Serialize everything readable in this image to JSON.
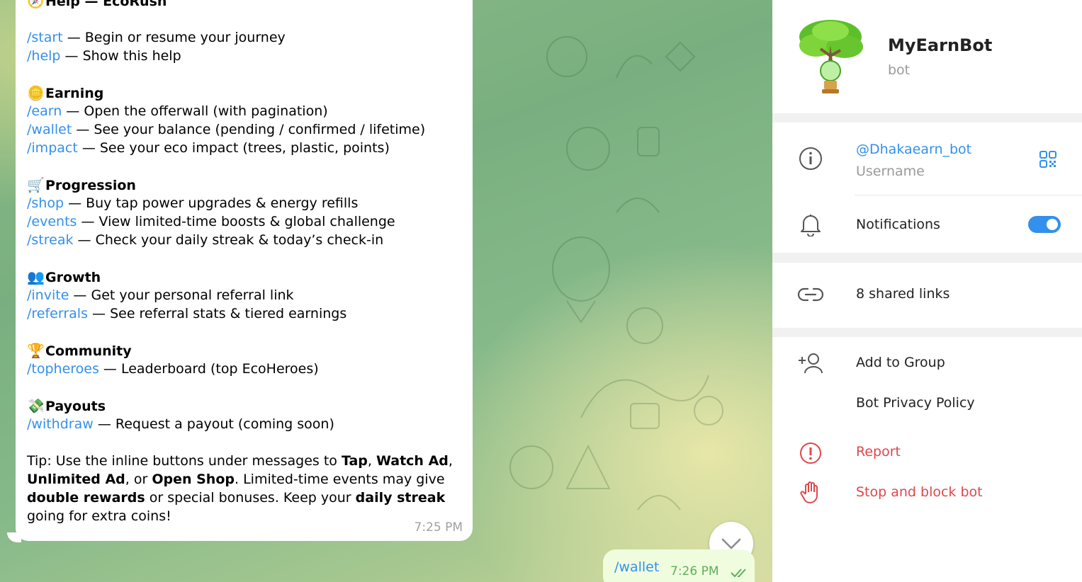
{
  "colors": {
    "accent": "#3390ec",
    "danger": "#e0474c",
    "outgoing_bubble": "#effdde"
  },
  "message": {
    "title_emoji": "🧭",
    "title": "Help — EcoRush",
    "intro_cmds": [
      {
        "cmd": "/start",
        "desc": " — Begin or resume your journey"
      },
      {
        "cmd": "/help",
        "desc": " — Show this help"
      }
    ],
    "sections": [
      {
        "emoji": "🪙",
        "name": "Earning",
        "cmds": [
          {
            "cmd": "/earn",
            "desc": " — Open the offerwall (with pagination)"
          },
          {
            "cmd": "/wallet",
            "desc": " — See your balance (pending / confirmed / lifetime)"
          },
          {
            "cmd": "/impact",
            "desc": " — See your eco impact (trees, plastic, points)"
          }
        ]
      },
      {
        "emoji": "🛒",
        "name": "Progression",
        "cmds": [
          {
            "cmd": "/shop",
            "desc": " — Buy tap power upgrades & energy refills"
          },
          {
            "cmd": "/events",
            "desc": " — View limited-time boosts & global challenge"
          },
          {
            "cmd": "/streak",
            "desc": " — Check your daily streak & today’s check-in"
          }
        ]
      },
      {
        "emoji": "👥",
        "name": "Growth",
        "cmds": [
          {
            "cmd": "/invite",
            "desc": " — Get your personal referral link"
          },
          {
            "cmd": "/referrals",
            "desc": " — See referral stats & tiered earnings"
          }
        ]
      },
      {
        "emoji": "🏆",
        "name": "Community",
        "cmds": [
          {
            "cmd": "/topheroes",
            "desc": " — Leaderboard (top EcoHeroes)"
          }
        ]
      },
      {
        "emoji": "💸",
        "name": "Payouts",
        "cmds": [
          {
            "cmd": "/withdraw",
            "desc": " — Request a payout (coming soon)"
          }
        ]
      }
    ],
    "tip": {
      "t1": "Tip: Use the inline buttons under messages to ",
      "b1": "Tap",
      "t2": ", ",
      "b2": "Watch Ad",
      "t3": ", ",
      "b3": "Unlimited Ad",
      "t4": ", or ",
      "b4": "Open Shop",
      "t5": ". Limited-time events may give ",
      "b5": "double rewards",
      "t6": " or special bonuses. Keep your ",
      "b6": "daily streak",
      "t7": " going for extra coins!"
    },
    "time": "7:25 PM"
  },
  "outgoing": {
    "text": "/wallet",
    "time": "7:26 PM"
  },
  "panel": {
    "bot_name": "MyEarnBot",
    "bot_type": "bot",
    "username": "@Dhakaearn_bot",
    "username_label": "Username",
    "notifications_label": "Notifications",
    "notifications_on": true,
    "shared_links": "8 shared links",
    "add_to_group": "Add to Group",
    "privacy_policy": "Bot Privacy Policy",
    "report": "Report",
    "stop_block": "Stop and block bot"
  }
}
